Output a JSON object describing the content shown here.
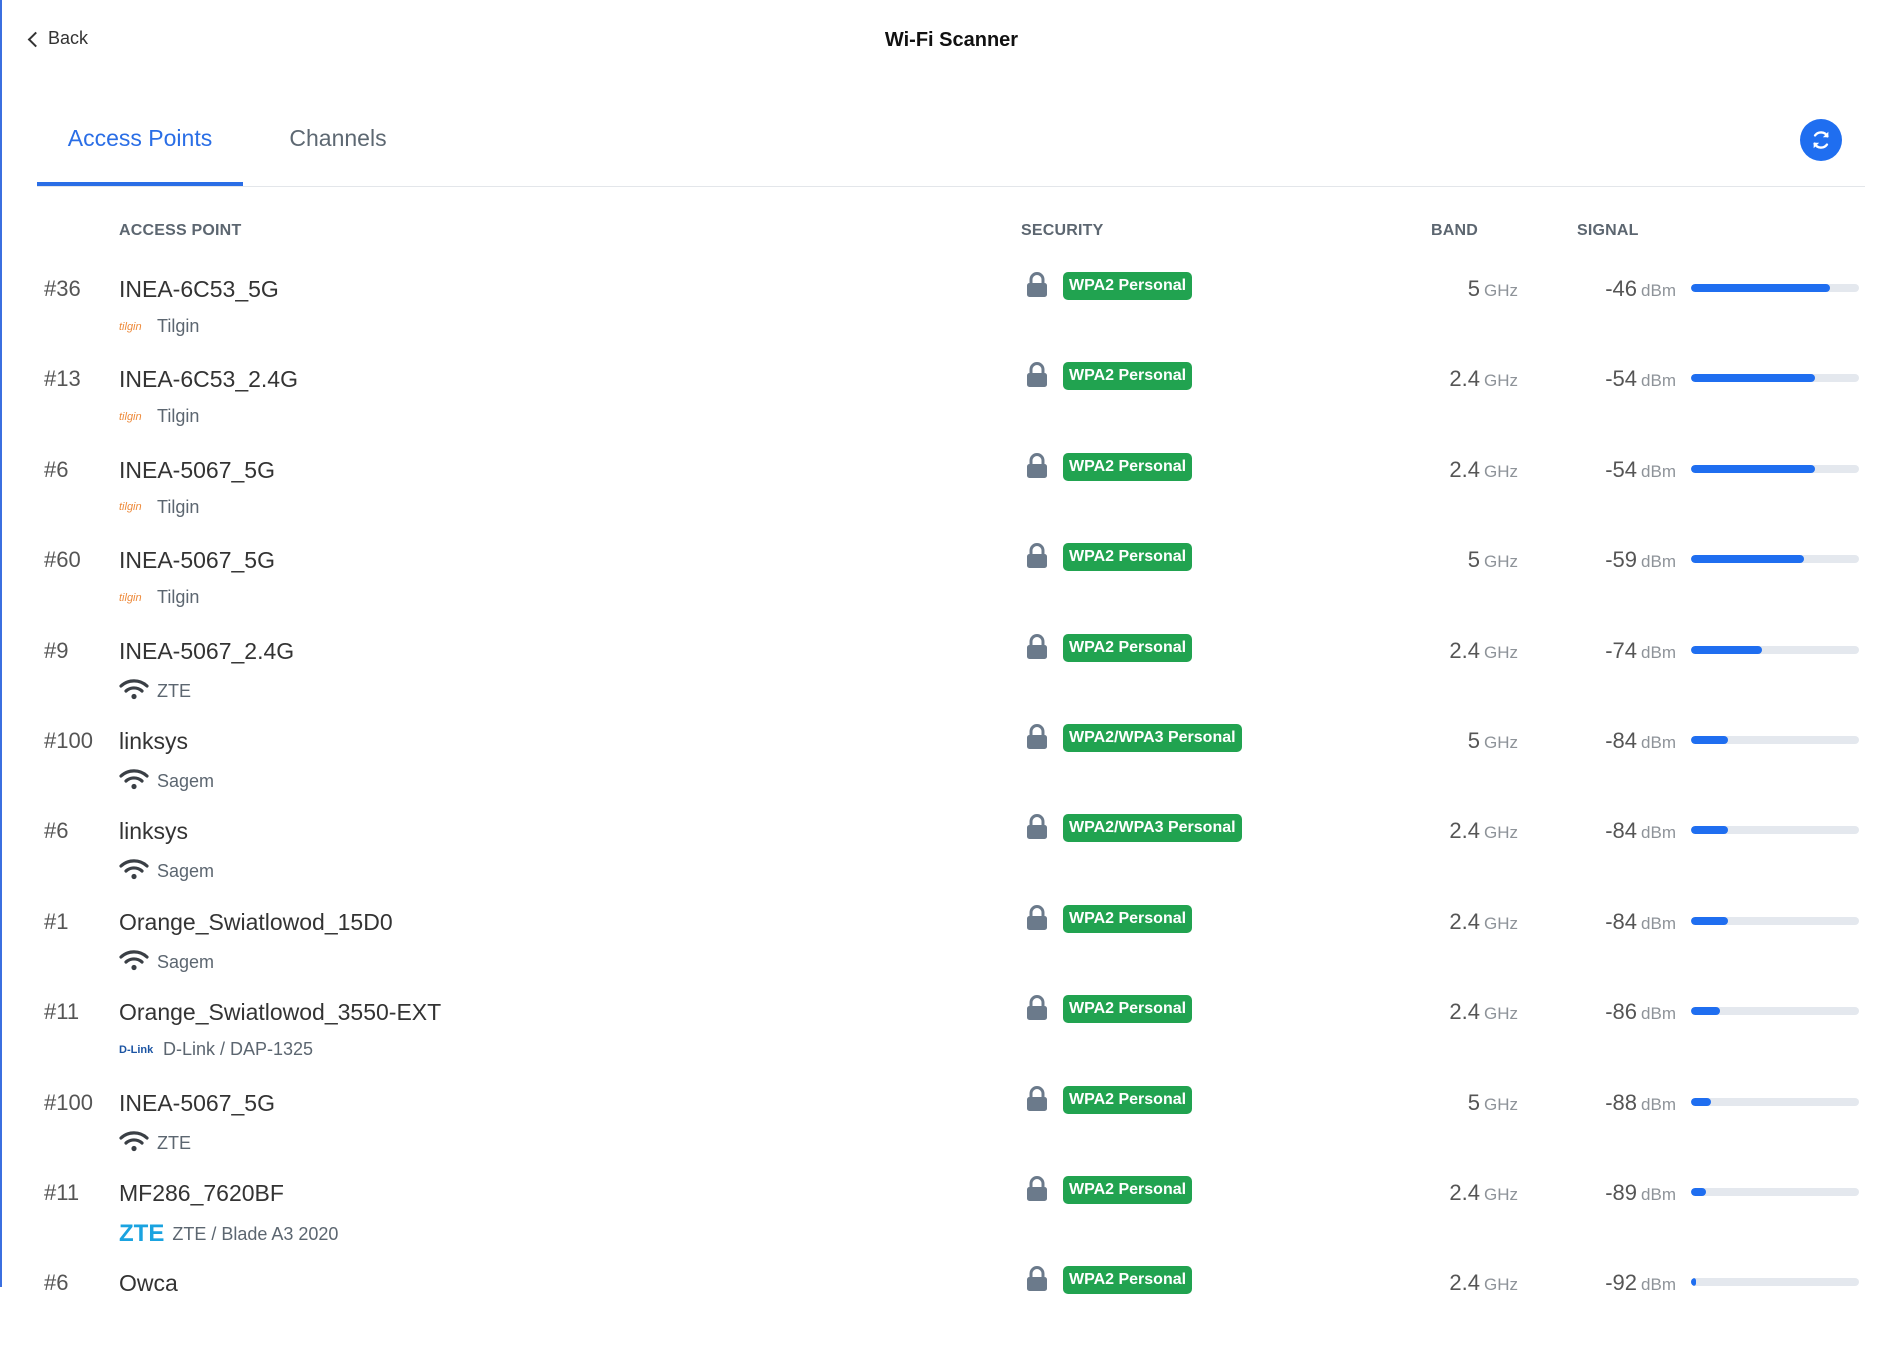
{
  "header": {
    "back_label": "Back",
    "title": "Wi-Fi Scanner"
  },
  "tabs": [
    {
      "label": "Access Points",
      "active": true
    },
    {
      "label": "Channels",
      "active": false
    }
  ],
  "refresh": {
    "icon": "refresh-icon"
  },
  "columns": {
    "access_point": "ACCESS POINT",
    "security": "SECURITY",
    "band": "BAND",
    "signal": "SIGNAL"
  },
  "colors": {
    "accent": "#1f6ef0",
    "badge": "#21a350"
  },
  "rows": [
    {
      "channel": "#36",
      "ssid": "INEA-6C53_5G",
      "vendor": "Tilgin",
      "vendor_logo": "tilgin",
      "security": "WPA2 Personal",
      "band": "5",
      "band_unit": "GHz",
      "signal": "-46",
      "signal_unit": "dBm",
      "signal_pct": 83
    },
    {
      "channel": "#13",
      "ssid": "INEA-6C53_2.4G",
      "vendor": "Tilgin",
      "vendor_logo": "tilgin",
      "security": "WPA2 Personal",
      "band": "2.4",
      "band_unit": "GHz",
      "signal": "-54",
      "signal_unit": "dBm",
      "signal_pct": 74
    },
    {
      "channel": "#6",
      "ssid": "INEA-5067_5G",
      "vendor": "Tilgin",
      "vendor_logo": "tilgin",
      "security": "WPA2 Personal",
      "band": "2.4",
      "band_unit": "GHz",
      "signal": "-54",
      "signal_unit": "dBm",
      "signal_pct": 74
    },
    {
      "channel": "#60",
      "ssid": "INEA-5067_5G",
      "vendor": "Tilgin",
      "vendor_logo": "tilgin",
      "security": "WPA2 Personal",
      "band": "5",
      "band_unit": "GHz",
      "signal": "-59",
      "signal_unit": "dBm",
      "signal_pct": 67
    },
    {
      "channel": "#9",
      "ssid": "INEA-5067_2.4G",
      "vendor": "ZTE",
      "vendor_logo": "wifi",
      "security": "WPA2 Personal",
      "band": "2.4",
      "band_unit": "GHz",
      "signal": "-74",
      "signal_unit": "dBm",
      "signal_pct": 42
    },
    {
      "channel": "#100",
      "ssid": "linksys",
      "vendor": "Sagem",
      "vendor_logo": "wifi",
      "security": "WPA2/WPA3 Personal",
      "band": "5",
      "band_unit": "GHz",
      "signal": "-84",
      "signal_unit": "dBm",
      "signal_pct": 22
    },
    {
      "channel": "#6",
      "ssid": "linksys",
      "vendor": "Sagem",
      "vendor_logo": "wifi",
      "security": "WPA2/WPA3 Personal",
      "band": "2.4",
      "band_unit": "GHz",
      "signal": "-84",
      "signal_unit": "dBm",
      "signal_pct": 22
    },
    {
      "channel": "#1",
      "ssid": "Orange_Swiatlowod_15D0",
      "vendor": "Sagem",
      "vendor_logo": "wifi",
      "security": "WPA2 Personal",
      "band": "2.4",
      "band_unit": "GHz",
      "signal": "-84",
      "signal_unit": "dBm",
      "signal_pct": 22
    },
    {
      "channel": "#11",
      "ssid": "Orange_Swiatlowod_3550-EXT",
      "vendor": "D-Link / DAP-1325",
      "vendor_logo": "dlink",
      "security": "WPA2 Personal",
      "band": "2.4",
      "band_unit": "GHz",
      "signal": "-86",
      "signal_unit": "dBm",
      "signal_pct": 17
    },
    {
      "channel": "#100",
      "ssid": "INEA-5067_5G",
      "vendor": "ZTE",
      "vendor_logo": "wifi",
      "security": "WPA2 Personal",
      "band": "5",
      "band_unit": "GHz",
      "signal": "-88",
      "signal_unit": "dBm",
      "signal_pct": 12
    },
    {
      "channel": "#11",
      "ssid": "MF286_7620BF",
      "vendor": "ZTE / Blade A3 2020",
      "vendor_logo": "zte",
      "security": "WPA2 Personal",
      "band": "2.4",
      "band_unit": "GHz",
      "signal": "-89",
      "signal_unit": "dBm",
      "signal_pct": 9
    },
    {
      "channel": "#6",
      "ssid": "Owca",
      "vendor": "",
      "vendor_logo": "",
      "security": "WPA2 Personal",
      "band": "2.4",
      "band_unit": "GHz",
      "signal": "-92",
      "signal_unit": "dBm",
      "signal_pct": 3
    }
  ]
}
